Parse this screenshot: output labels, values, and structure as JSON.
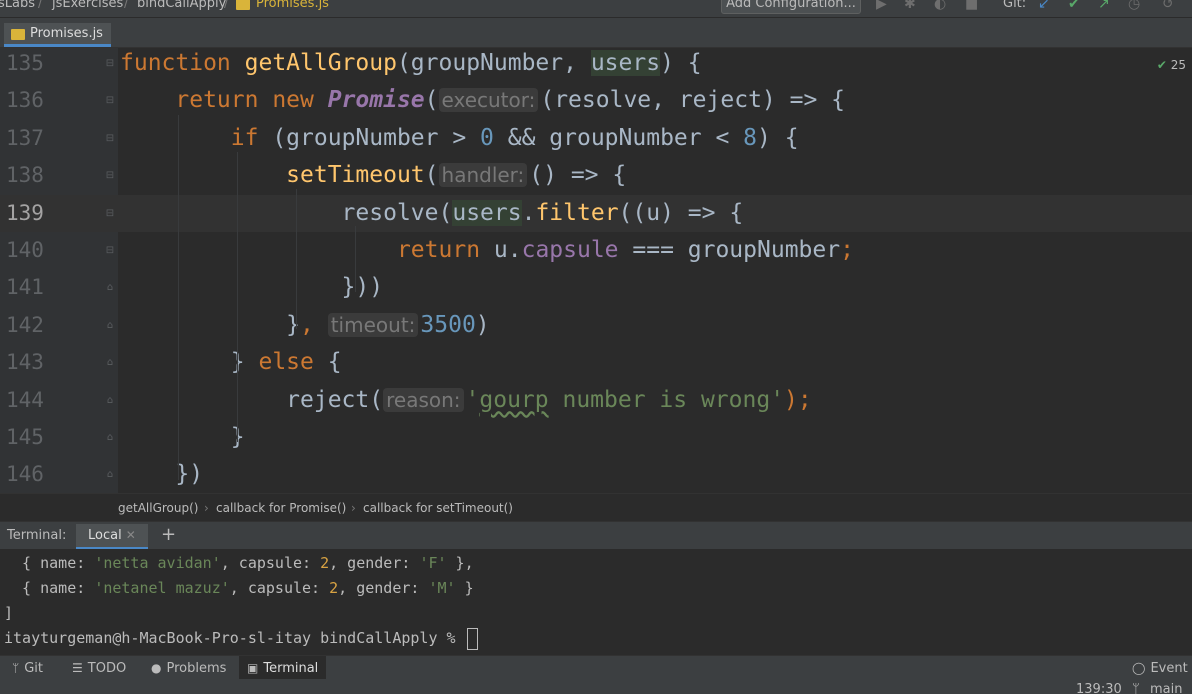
{
  "navbar": {
    "crumbs": [
      "sLabs",
      "jsExercises",
      "bindCallApply",
      "Promises.js"
    ],
    "config_button": "Add Configuration...",
    "git_label": "Git:"
  },
  "editor_tab": {
    "label": "Promises.js",
    "file_icon": "js-file-icon"
  },
  "editor": {
    "problems_count": "25",
    "line_numbers": [
      "135",
      "136",
      "137",
      "138",
      "139",
      "140",
      "141",
      "142",
      "143",
      "144",
      "145",
      "146"
    ],
    "caret_line": "139",
    "lines": [
      [
        {
          "t": "function ",
          "c": "kw"
        },
        {
          "t": "getAllGroup",
          "c": "fn"
        },
        {
          "t": "(groupNumber, "
        },
        {
          "t": "users",
          "c": "hl-usage"
        },
        {
          "t": ") {"
        }
      ],
      [
        {
          "t": "    "
        },
        {
          "t": "return ",
          "c": "kw"
        },
        {
          "t": "new ",
          "c": "kw"
        },
        {
          "t": "Promise",
          "c": "cls"
        },
        {
          "t": "("
        },
        {
          "t": "executor:",
          "c": "hint"
        },
        {
          "t": "(resolve, reject) => {"
        }
      ],
      [
        {
          "t": "        "
        },
        {
          "t": "if ",
          "c": "kw"
        },
        {
          "t": "(groupNumber > "
        },
        {
          "t": "0",
          "c": "num"
        },
        {
          "t": " && groupNumber < "
        },
        {
          "t": "8",
          "c": "num"
        },
        {
          "t": ") {"
        }
      ],
      [
        {
          "t": "            "
        },
        {
          "t": "setTimeout",
          "c": "fn"
        },
        {
          "t": "("
        },
        {
          "t": "handler:",
          "c": "hint"
        },
        {
          "t": "() => {"
        }
      ],
      [
        {
          "t": "                resolve("
        },
        {
          "t": "users",
          "c": "hl-usage"
        },
        {
          "t": "."
        },
        {
          "t": "filter",
          "c": "fn"
        },
        {
          "t": "((u) => {"
        }
      ],
      [
        {
          "t": "                    "
        },
        {
          "t": "return ",
          "c": "kw"
        },
        {
          "t": "u."
        },
        {
          "t": "capsule",
          "c": "prop"
        },
        {
          "t": " === groupNumber"
        },
        {
          "t": ";",
          "c": "kw"
        }
      ],
      [
        {
          "t": "                }))"
        }
      ],
      [
        {
          "t": "            }"
        },
        {
          "t": ", ",
          "c": "kw"
        },
        {
          "t": "timeout:",
          "c": "hint"
        },
        {
          "t": "3500",
          "c": "num"
        },
        {
          "t": ")"
        }
      ],
      [
        {
          "t": "        } "
        },
        {
          "t": "else ",
          "c": "kw"
        },
        {
          "t": "{"
        }
      ],
      [
        {
          "t": "            reject("
        },
        {
          "t": "reason:",
          "c": "hint"
        },
        {
          "t": "'",
          "c": "str"
        },
        {
          "t": "gourp",
          "c": "str typo"
        },
        {
          "t": " number is wrong'",
          "c": "str"
        },
        {
          "t": ");",
          "c": "kw"
        }
      ],
      [
        {
          "t": "        }"
        }
      ],
      [
        {
          "t": "    })"
        }
      ]
    ]
  },
  "breadcrumbs": [
    "getAllGroup()",
    "callback for Promise()",
    "callback for setTimeout()"
  ],
  "terminal": {
    "title": "Terminal:",
    "tab_label": "Local",
    "lines": [
      [
        {
          "t": "  { name: "
        },
        {
          "t": "'netta avidan'",
          "c": "t-str"
        },
        {
          "t": ", capsule: "
        },
        {
          "t": "2",
          "c": "t-num"
        },
        {
          "t": ", gender: "
        },
        {
          "t": "'F'",
          "c": "t-str"
        },
        {
          "t": " },"
        }
      ],
      [
        {
          "t": "  { name: "
        },
        {
          "t": "'netanel mazuz'",
          "c": "t-str"
        },
        {
          "t": ", capsule: "
        },
        {
          "t": "2",
          "c": "t-num"
        },
        {
          "t": ", gender: "
        },
        {
          "t": "'M'",
          "c": "t-str"
        },
        {
          "t": " }"
        }
      ],
      [
        {
          "t": "]"
        }
      ],
      [
        {
          "t": "itayturgeman@h-MacBook-Pro-sl-itay bindCallApply % "
        }
      ]
    ]
  },
  "tools": {
    "git": "Git",
    "todo": "TODO",
    "problems": "Problems",
    "terminal": "Terminal",
    "event_log": "Event L"
  },
  "status": {
    "position": "139:30",
    "branch": "main"
  }
}
